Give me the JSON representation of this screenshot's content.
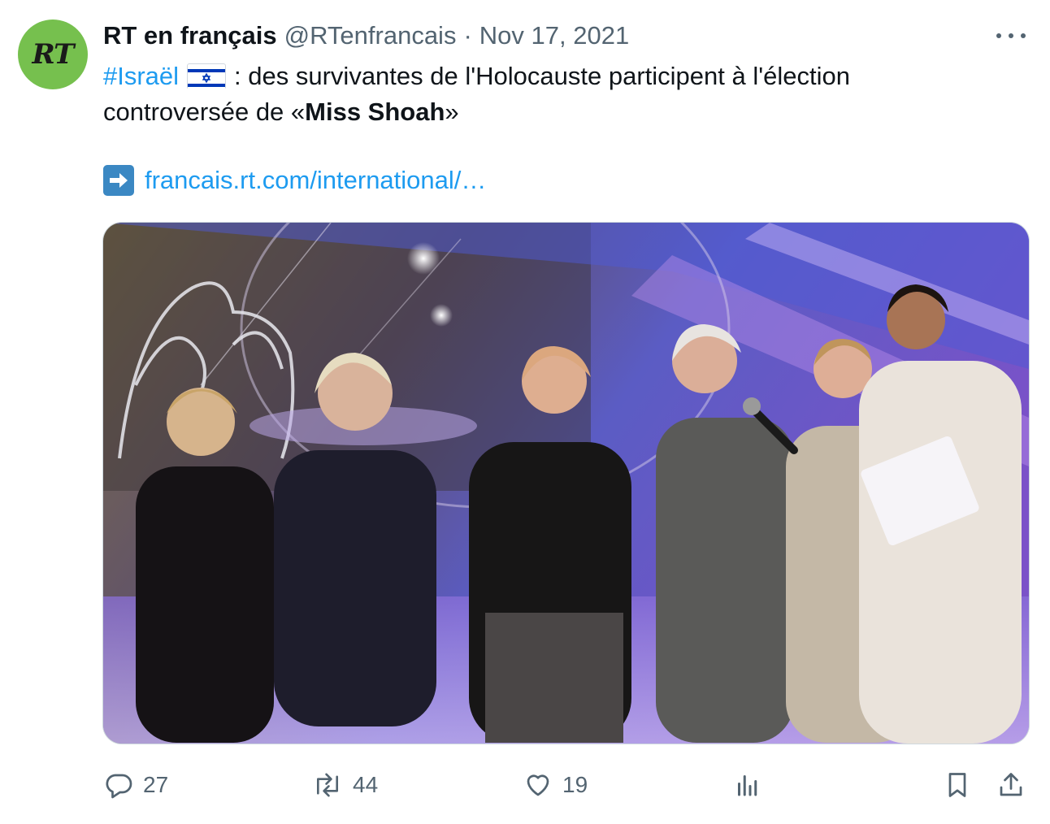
{
  "tweet": {
    "author_name": "RT en français",
    "handle": "@RTenfrancais",
    "separator": "·",
    "date": "Nov 17, 2021",
    "avatar_text": "RT",
    "text": {
      "hashtag": "#Israël",
      "line1_rest": ": des survivantes de l'Holocauste participent à l'élection",
      "line2_prefix": "controversée de «",
      "line2_bold": "Miss Shoah",
      "line2_suffix": "»",
      "link": "francais.rt.com/international/…"
    },
    "media_alt": "Photo: women on stage at Miss Shoah pageant with a presenter holding a microphone",
    "actions": {
      "replies": "27",
      "retweets": "44",
      "likes": "19"
    }
  },
  "colors": {
    "avatar_bg": "#76c04e",
    "link": "#1d9bf0",
    "muted": "#536471"
  },
  "icons": [
    "more-icon",
    "israel-flag-icon",
    "right-arrow-icon",
    "reply-icon",
    "retweet-icon",
    "like-icon",
    "views-icon",
    "bookmark-icon",
    "share-icon"
  ]
}
